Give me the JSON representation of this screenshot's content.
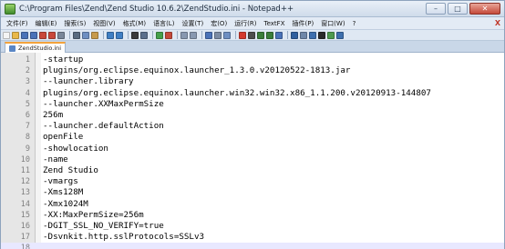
{
  "window": {
    "title": "C:\\Program Files\\Zend\\Zend Studio 10.6.2\\ZendStudio.ini - Notepad++",
    "controls": {
      "minimize": "–",
      "maximize": "□",
      "close": "✕"
    }
  },
  "menubar": {
    "items": [
      {
        "label": "文件(F)"
      },
      {
        "label": "编辑(E)"
      },
      {
        "label": "搜索(S)"
      },
      {
        "label": "视图(V)"
      },
      {
        "label": "格式(M)"
      },
      {
        "label": "语言(L)"
      },
      {
        "label": "设置(T)"
      },
      {
        "label": "宏(O)"
      },
      {
        "label": "运行(R)"
      },
      {
        "label": "TextFX"
      },
      {
        "label": "插件(P)"
      },
      {
        "label": "窗口(W)"
      },
      {
        "label": "?"
      }
    ],
    "close_label": "X"
  },
  "toolbar": {
    "buttons": [
      {
        "icon": "new-file-icon",
        "color": "#f4f4f4"
      },
      {
        "icon": "open-file-icon",
        "color": "#e9b84a"
      },
      {
        "icon": "save-icon",
        "color": "#4a72b8"
      },
      {
        "icon": "save-all-icon",
        "color": "#4a72b8"
      },
      {
        "icon": "close-file-icon",
        "color": "#c9483a"
      },
      {
        "icon": "close-all-icon",
        "color": "#c9483a"
      },
      {
        "icon": "print-icon",
        "color": "#7a8799"
      },
      {
        "icon": "sep"
      },
      {
        "icon": "cut-icon",
        "color": "#5a6b80"
      },
      {
        "icon": "copy-icon",
        "color": "#6e8fc2"
      },
      {
        "icon": "paste-icon",
        "color": "#c79a4b"
      },
      {
        "icon": "sep"
      },
      {
        "icon": "undo-icon",
        "color": "#3f7fc4"
      },
      {
        "icon": "redo-icon",
        "color": "#3f7fc4"
      },
      {
        "icon": "sep"
      },
      {
        "icon": "find-icon",
        "color": "#3a3a3a"
      },
      {
        "icon": "replace-icon",
        "color": "#5b6f8c"
      },
      {
        "icon": "sep"
      },
      {
        "icon": "zoom-in-icon",
        "color": "#45a04b"
      },
      {
        "icon": "zoom-out-icon",
        "color": "#c44a3b"
      },
      {
        "icon": "sep"
      },
      {
        "icon": "sync-v-icon",
        "color": "#8898b0"
      },
      {
        "icon": "sync-h-icon",
        "color": "#8898b0"
      },
      {
        "icon": "sep"
      },
      {
        "icon": "word-wrap-icon",
        "color": "#4a72b8"
      },
      {
        "icon": "all-chars-icon",
        "color": "#7b8ba3"
      },
      {
        "icon": "indent-guide-icon",
        "color": "#6e8fc2"
      },
      {
        "icon": "sep"
      },
      {
        "icon": "record-macro-icon",
        "color": "#d43a2e"
      },
      {
        "icon": "stop-macro-icon",
        "color": "#4d4d4d"
      },
      {
        "icon": "play-macro-icon",
        "color": "#3a7d3a"
      },
      {
        "icon": "run-macro-icon",
        "color": "#3a7d3a"
      },
      {
        "icon": "save-macro-icon",
        "color": "#4a72b8"
      },
      {
        "icon": "sep"
      },
      {
        "icon": "list-icon",
        "color": "#2f5f9e"
      },
      {
        "icon": "doc-map-icon",
        "color": "#6f87a8"
      },
      {
        "icon": "function-list-icon",
        "color": "#3e6fae"
      },
      {
        "icon": "monitor-icon",
        "color": "#2a2a2a"
      },
      {
        "icon": "folder-icon",
        "color": "#4e9a4e"
      },
      {
        "icon": "panel-icon",
        "color": "#3e6fae"
      }
    ]
  },
  "tab": {
    "label": "ZendStudio.ini"
  },
  "editor": {
    "current_line": 18,
    "lines": [
      {
        "n": "1",
        "text": "-startup"
      },
      {
        "n": "2",
        "text": "plugins/org.eclipse.equinox.launcher_1.3.0.v20120522-1813.jar"
      },
      {
        "n": "3",
        "text": "--launcher.library"
      },
      {
        "n": "4",
        "text": "plugins/org.eclipse.equinox.launcher.win32.win32.x86_1.1.200.v20120913-144807"
      },
      {
        "n": "5",
        "text": "--launcher.XXMaxPermSize"
      },
      {
        "n": "6",
        "text": "256m"
      },
      {
        "n": "7",
        "text": "--launcher.defaultAction"
      },
      {
        "n": "8",
        "text": "openFile"
      },
      {
        "n": "9",
        "text": "-showlocation"
      },
      {
        "n": "10",
        "text": "-name"
      },
      {
        "n": "11",
        "text": "Zend Studio"
      },
      {
        "n": "12",
        "text": "-vmargs"
      },
      {
        "n": "13",
        "text": "-Xms128M"
      },
      {
        "n": "14",
        "text": "-Xmx1024M"
      },
      {
        "n": "15",
        "text": "-XX:MaxPermSize=256m"
      },
      {
        "n": "16",
        "text": "-DGIT_SSL_NO_VERIFY=true"
      },
      {
        "n": "17",
        "text": "-Dsvnkit.http.sslProtocols=SSLv3"
      },
      {
        "n": "18",
        "text": ""
      }
    ]
  }
}
